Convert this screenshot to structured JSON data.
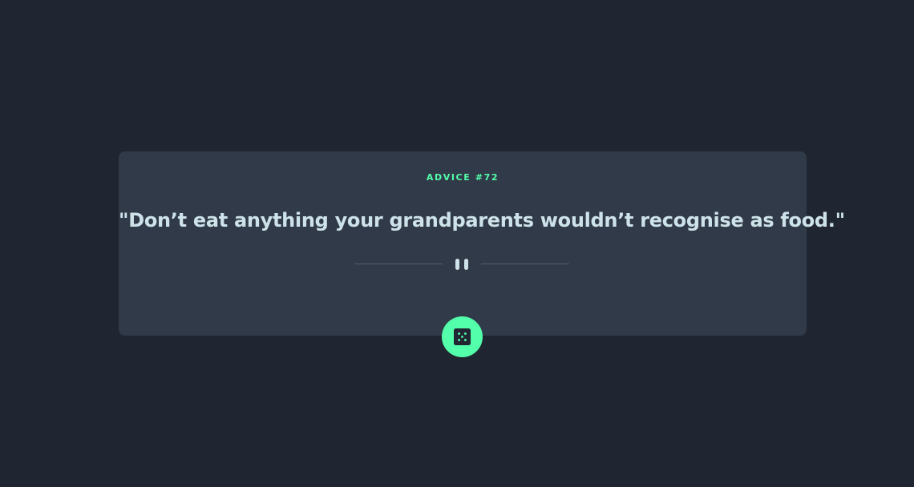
{
  "card": {
    "advice_label": "ADVICE #72",
    "quote": "\"Don’t eat anything your grandparents wouldn’t recognise as food.\""
  },
  "divider": {
    "icon": "pause-icon"
  },
  "button": {
    "icon": "dice-icon",
    "accent_color": "#53ffaa"
  },
  "colors": {
    "background": "#1f2632",
    "card": "#313a49",
    "accent": "#53ffaa",
    "text": "#cee3e9"
  }
}
